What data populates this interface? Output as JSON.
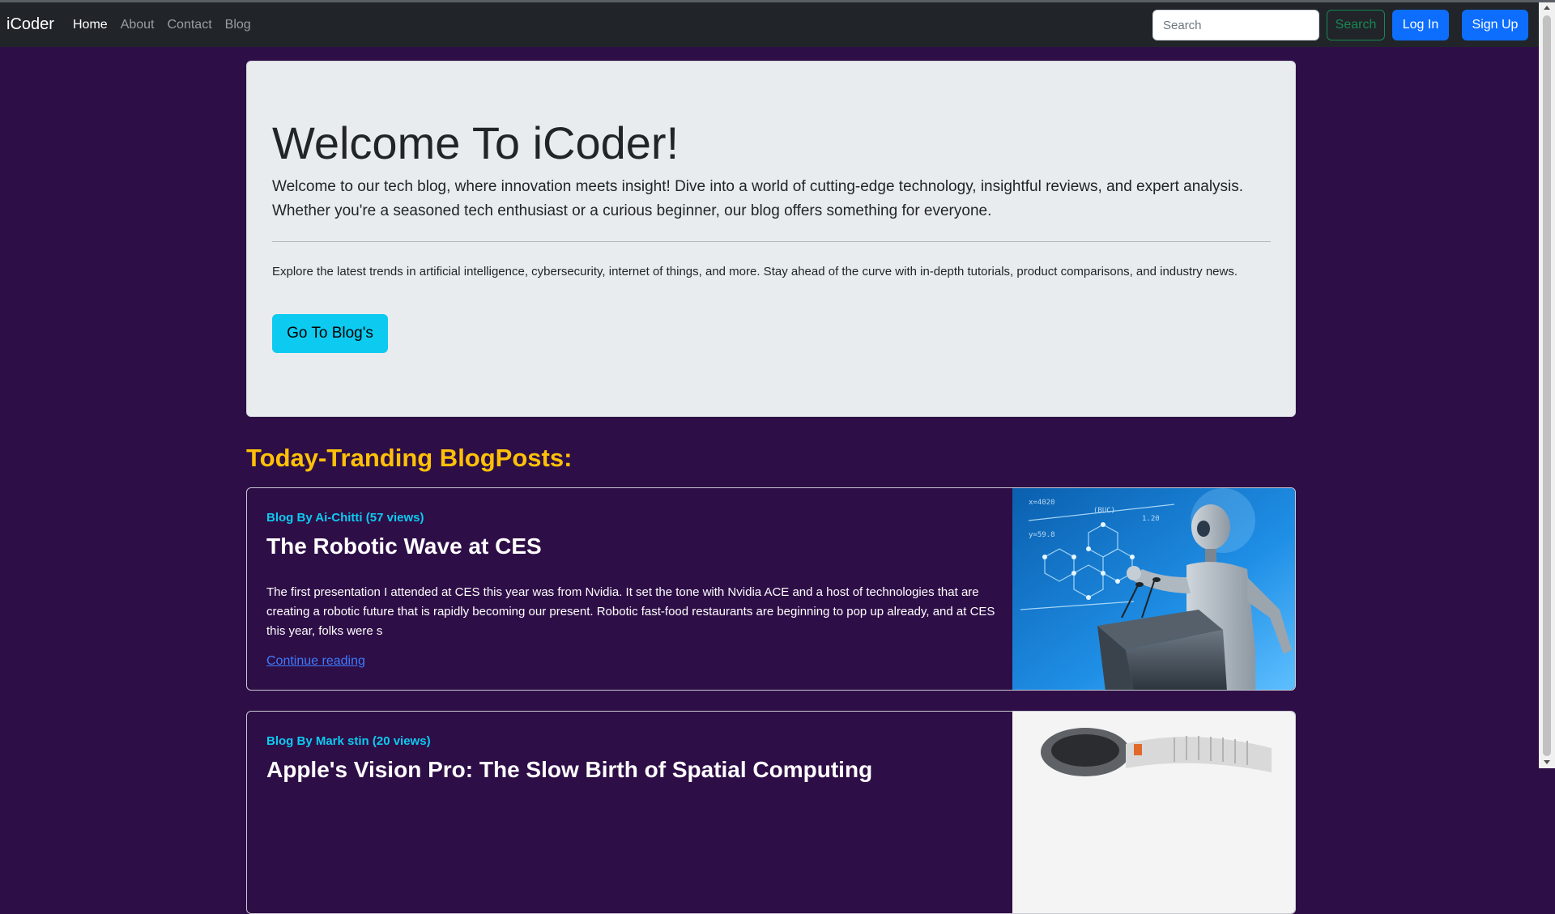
{
  "navbar": {
    "brand": "iCoder",
    "links": [
      {
        "label": "Home",
        "active": true
      },
      {
        "label": "About"
      },
      {
        "label": "Contact"
      },
      {
        "label": "Blog"
      }
    ],
    "search_placeholder": "Search",
    "search_button": "Search",
    "login_button": "Log In",
    "signup_button": "Sign Up"
  },
  "hero": {
    "title": "Welcome To iCoder!",
    "lead": "Welcome to our tech blog, where innovation meets insight! Dive into a world of cutting-edge technology, insightful reviews, and expert analysis. Whether you're a seasoned tech enthusiast or a curious beginner, our blog offers something for everyone.",
    "text": "Explore the latest trends in artificial intelligence, cybersecurity, internet of things, and more. Stay ahead of the curve with in-depth tutorials, product comparisons, and industry news.",
    "button": "Go To Blog's"
  },
  "trending": {
    "heading": "Today-Tranding BlogPosts:",
    "posts": [
      {
        "author": "Blog By Ai-Chitti (57 views)",
        "title": "The Robotic Wave at CES",
        "excerpt": "The first presentation I attended at CES this year was from Nvidia. It set the tone with Nvidia ACE and a host of technologies that are creating a robotic future that is rapidly becoming our present. Robotic fast-food restaurants are beginning to pop up already, and at CES this year, folks were s",
        "link": "Continue reading"
      },
      {
        "author": "Blog By Mark stin (20 views)",
        "title": "Apple's Vision Pro: The Slow Birth of Spatial Computing",
        "excerpt": "",
        "link": ""
      }
    ]
  },
  "colors": {
    "page_bg": "#2e0e47",
    "navbar_bg": "#212529",
    "hero_bg": "#e9ecef",
    "accent_yellow": "#ffc107",
    "accent_cyan": "#0dcaf0",
    "primary_blue": "#0d6efd",
    "success_green": "#198754"
  },
  "icons": {
    "scroll_up": "chevron-up-icon",
    "scroll_down": "chevron-down-icon"
  }
}
